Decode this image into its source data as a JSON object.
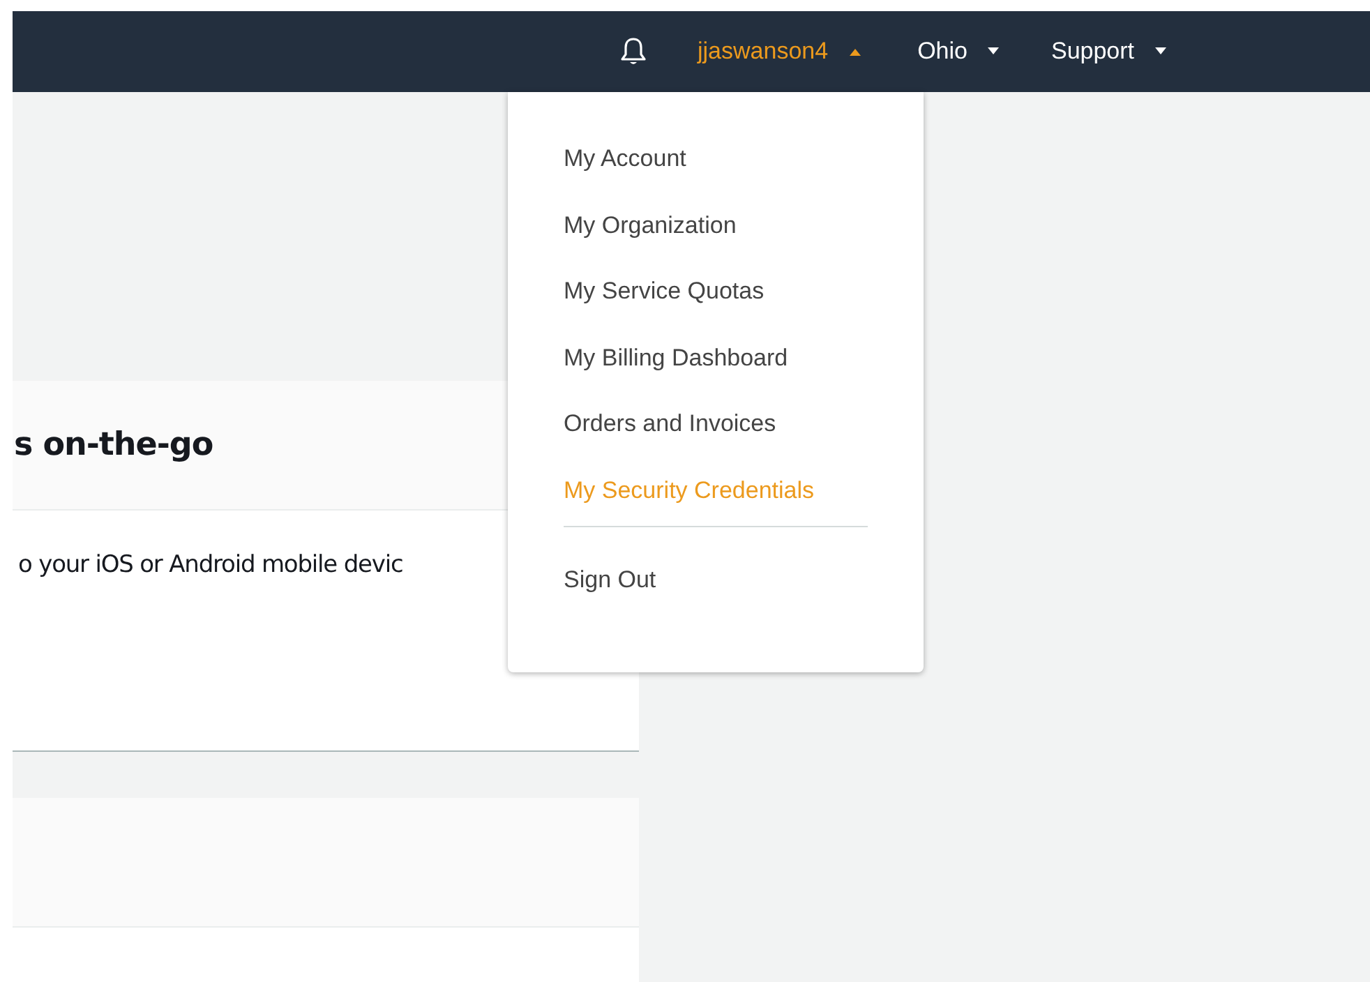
{
  "navbar": {
    "user_menu": {
      "label": "jjaswanson4",
      "expanded": true
    },
    "region_menu": {
      "label": "Ohio",
      "expanded": false
    },
    "support_menu": {
      "label": "Support",
      "expanded": false
    }
  },
  "cards": [
    {
      "heading": "s on-the-go",
      "body": "o your iOS or Android mobile devic"
    }
  ],
  "dropdown": {
    "items": [
      {
        "label": "My Account",
        "selected": false
      },
      {
        "label": "My Organization",
        "selected": false
      },
      {
        "label": "My Service Quotas",
        "selected": false
      },
      {
        "label": "My Billing Dashboard",
        "selected": false
      },
      {
        "label": "Orders and Invoices",
        "selected": false
      },
      {
        "label": "My Security Credentials",
        "selected": true
      }
    ],
    "footer_items": [
      {
        "label": "Sign Out",
        "selected": false
      }
    ]
  }
}
